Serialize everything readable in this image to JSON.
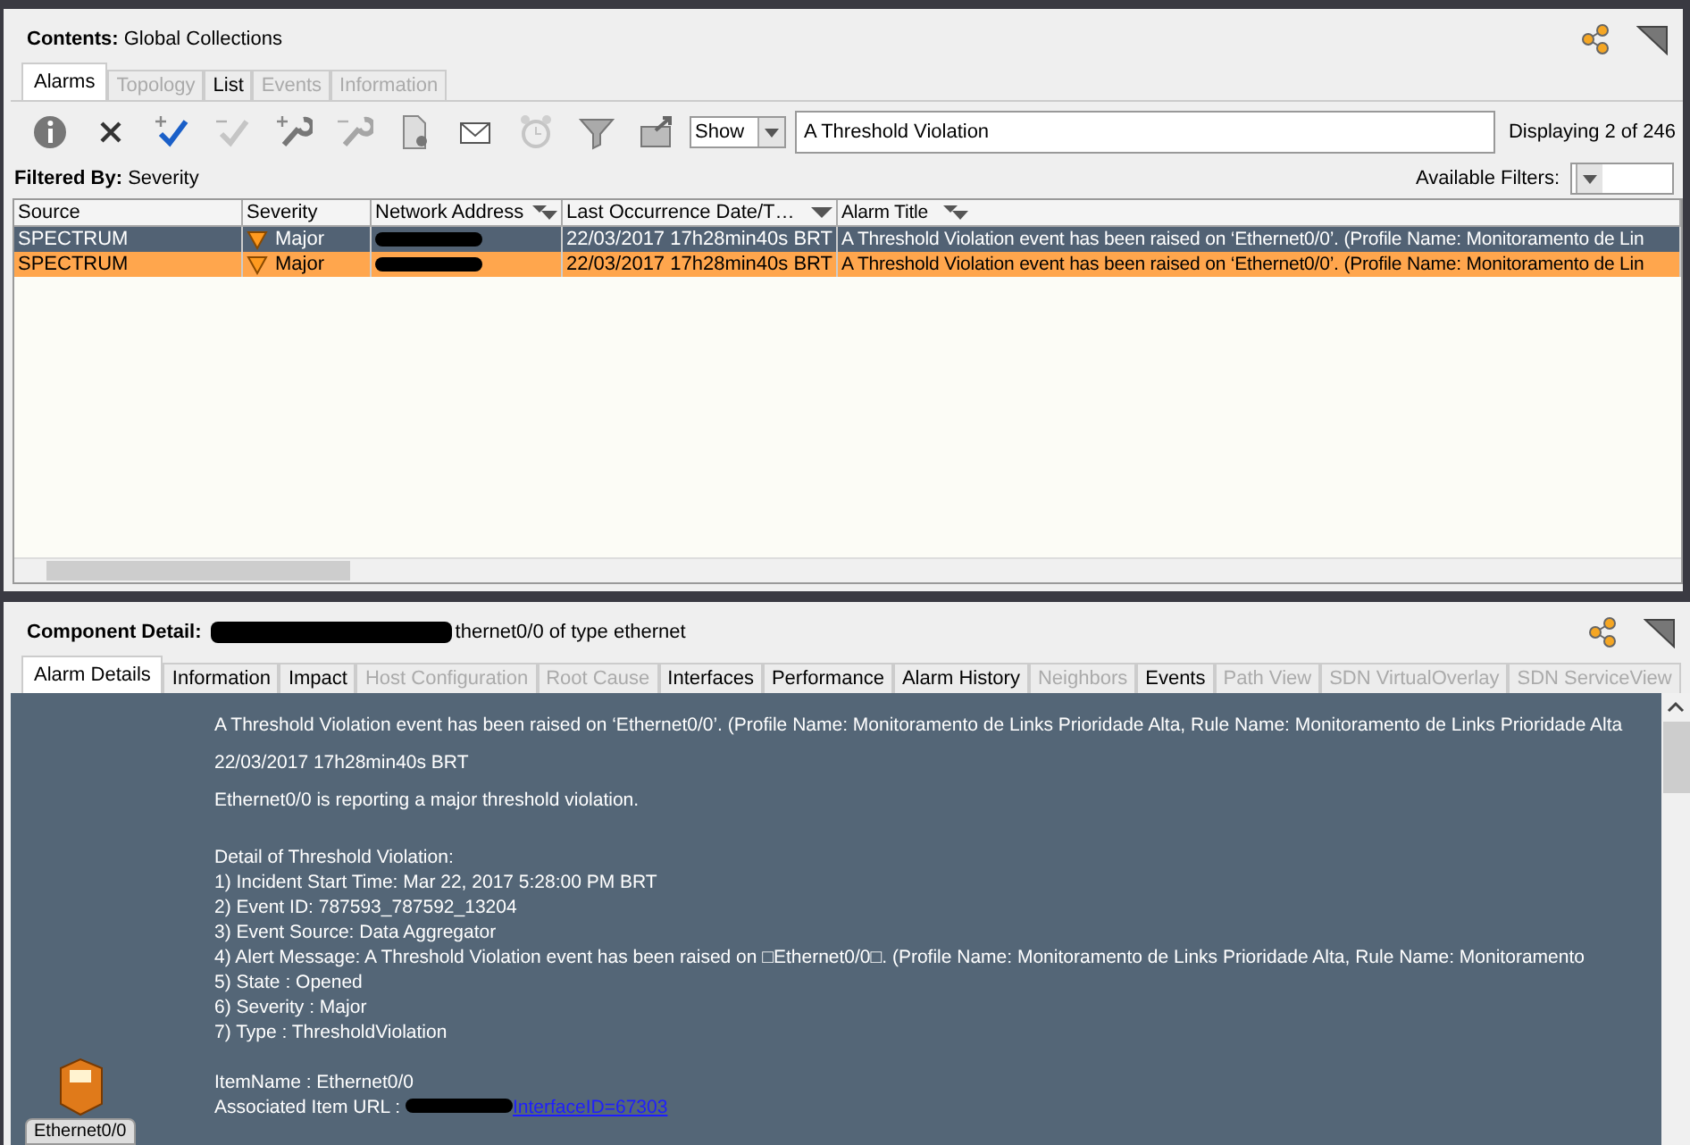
{
  "contents": {
    "label": "Contents:",
    "value": "Global Collections"
  },
  "tabs": [
    {
      "label": "Alarms",
      "selected": true,
      "disabled": false
    },
    {
      "label": "Topology",
      "selected": false,
      "disabled": true
    },
    {
      "label": "List",
      "selected": false,
      "disabled": false
    },
    {
      "label": "Events",
      "selected": false,
      "disabled": true
    },
    {
      "label": "Information",
      "selected": false,
      "disabled": true
    }
  ],
  "toolbar": [
    {
      "kind": "info",
      "disabled": false
    },
    {
      "kind": "clear",
      "disabled": false
    },
    {
      "kind": "ack",
      "disabled": false
    },
    {
      "kind": "unack",
      "disabled": true
    },
    {
      "kind": "wrench-add",
      "disabled": false
    },
    {
      "kind": "wrench-remove",
      "disabled": true
    },
    {
      "kind": "document",
      "disabled": false
    },
    {
      "kind": "mail",
      "disabled": false
    },
    {
      "kind": "clock",
      "disabled": true
    },
    {
      "kind": "funnel",
      "disabled": false
    },
    {
      "kind": "folder",
      "disabled": false
    }
  ],
  "show_select": {
    "value": "Show"
  },
  "filter_field": {
    "value": "A Threshold Violation"
  },
  "displaying": "Displaying 2 of 246",
  "filtered_by": {
    "label": "Filtered By:",
    "value": "Severity"
  },
  "available_filters": {
    "label": "Available Filters:"
  },
  "table": {
    "columns": [
      {
        "label": "Source",
        "kind": "plain"
      },
      {
        "label": "Severity",
        "kind": "plain"
      },
      {
        "label": "Network Address",
        "kind": "multi"
      },
      {
        "label": "Last Occurrence Date/T…",
        "kind": "down"
      },
      {
        "label": "Alarm Title",
        "kind": "multi"
      }
    ],
    "rows": [
      {
        "selected": true,
        "source": "SPECTRUM",
        "severity": "Major",
        "date": "22/03/2017 17h28min40s BRT",
        "title": "A Threshold Violation event has been raised on ‘Ethernet0/0’. (Profile Name: Monitoramento de Lin"
      },
      {
        "selected": false,
        "source": "SPECTRUM",
        "severity": "Major",
        "date": "22/03/2017 17h28min40s BRT",
        "title": "A Threshold Violation event has been raised on ‘Ethernet0/0’. (Profile Name: Monitoramento de Lin"
      }
    ]
  },
  "detail": {
    "label": "Component Detail:",
    "value": "thernet0/0 of type ethernet"
  },
  "detail_tabs": [
    {
      "label": "Alarm Details",
      "selected": true,
      "disabled": false
    },
    {
      "label": "Information",
      "selected": false,
      "disabled": false
    },
    {
      "label": "Impact",
      "selected": false,
      "disabled": false
    },
    {
      "label": "Host Configuration",
      "selected": false,
      "disabled": true
    },
    {
      "label": "Root Cause",
      "selected": false,
      "disabled": true
    },
    {
      "label": "Interfaces",
      "selected": false,
      "disabled": false
    },
    {
      "label": "Performance",
      "selected": false,
      "disabled": false
    },
    {
      "label": "Alarm History",
      "selected": false,
      "disabled": false
    },
    {
      "label": "Neighbors",
      "selected": false,
      "disabled": true
    },
    {
      "label": "Events",
      "selected": false,
      "disabled": false
    },
    {
      "label": "Path View",
      "selected": false,
      "disabled": true
    },
    {
      "label": "SDN VirtualOverlay",
      "selected": false,
      "disabled": true
    },
    {
      "label": "SDN ServiceView",
      "selected": false,
      "disabled": true
    }
  ],
  "alarm_details": {
    "lines": [
      {
        "kind": "text",
        "text": "A Threshold Violation event has been raised on ‘Ethernet0/0’. (Profile Name: Monitoramento de Links Prioridade Alta, Rule Name: Monitoramento de Links Prioridade Alta"
      },
      {
        "kind": "text",
        "text": "22/03/2017 17h28min40s BRT"
      },
      {
        "kind": "text",
        "text": "Ethernet0/0 is reporting a major threshold violation."
      },
      {
        "kind": "gap"
      },
      {
        "kind": "tight",
        "text": "Detail of Threshold Violation:"
      },
      {
        "kind": "tight",
        "text": "1) Incident Start Time: Mar 22, 2017 5:28:00 PM BRT"
      },
      {
        "kind": "tight",
        "text": "2) Event ID: 787593_787592_13204"
      },
      {
        "kind": "tight",
        "text": "3) Event Source: Data Aggregator"
      },
      {
        "kind": "tight",
        "text": "4) Alert Message: A Threshold Violation event has been raised on □Ethernet0/0□. (Profile Name: Monitoramento de Links Prioridade Alta, Rule Name: Monitoramento"
      },
      {
        "kind": "tight",
        "text": "5) State : Opened"
      },
      {
        "kind": "tight",
        "text": "6) Severity : Major"
      },
      {
        "kind": "tight",
        "text": "7) Type : ThresholdViolation"
      },
      {
        "kind": "gap"
      },
      {
        "kind": "tight",
        "text": "ItemName : Ethernet0/0"
      },
      {
        "kind": "url",
        "text": "Associated Item URL :",
        "link": "InterfaceID=67303"
      }
    ],
    "device_label": "Ethernet0/0"
  }
}
